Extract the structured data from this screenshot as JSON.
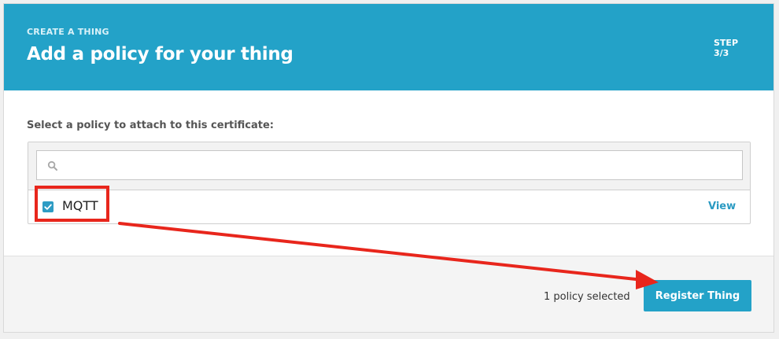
{
  "header": {
    "eyebrow": "CREATE A THING",
    "title": "Add a policy for your thing",
    "step_label": "STEP",
    "step_value": "3/3"
  },
  "content": {
    "prompt": "Select a policy to attach to this certificate:",
    "search": {
      "value": "",
      "placeholder": ""
    },
    "policies": [
      {
        "name": "MQTT",
        "checked": true,
        "action_label": "View"
      }
    ]
  },
  "footer": {
    "selected_count_text": "1 policy selected",
    "register_label": "Register Thing"
  },
  "colors": {
    "accent": "#23a2c8",
    "link": "#2a9ac2",
    "annotation": "#e8261c"
  },
  "icons": {
    "search": "search-icon",
    "checkbox": "checkmark-icon"
  }
}
